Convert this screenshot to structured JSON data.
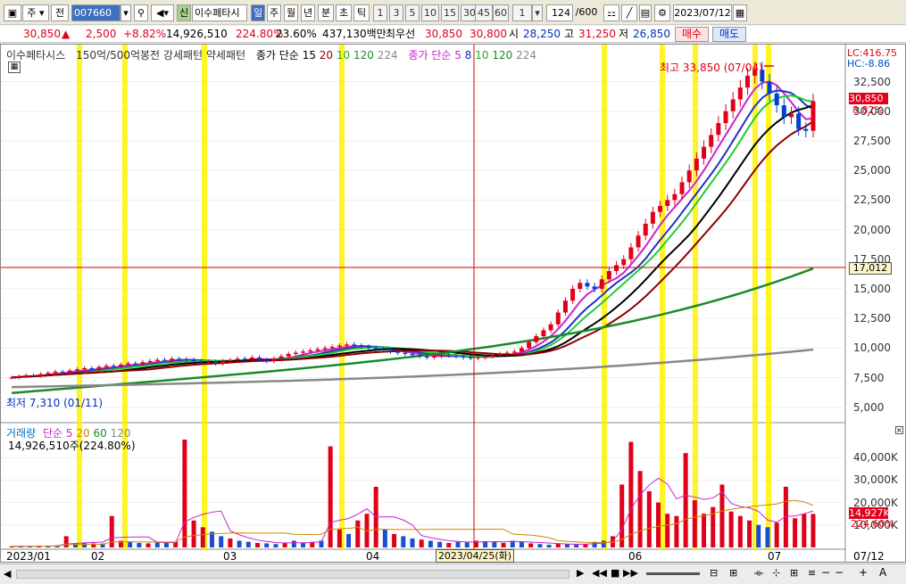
{
  "toolbar": {
    "market": "주",
    "market_type": "전",
    "code": "007660",
    "new_badge": "신",
    "stock_name": "이수페타시",
    "periods": [
      "일",
      "주",
      "월",
      "년",
      "분",
      "초",
      "틱"
    ],
    "selected_period": "일",
    "minute_intervals": [
      "1",
      "3",
      "5",
      "10",
      "15",
      "30",
      "45",
      "60"
    ],
    "interval_value": "1",
    "count": "124",
    "count_total": "/600",
    "date": "2023/07/12"
  },
  "info": {
    "price": "30,850",
    "change_arrow": "▲",
    "change": "2,500",
    "change_pct": "+8.82%",
    "volume": "14,926,510",
    "volume_ratio": "224.80%",
    "turnover": "23.60%",
    "amount": "437,130백만",
    "best_label": "최우선",
    "best_ask": "30,850",
    "best_bid": "30,800",
    "open_label": "시",
    "open": "28,250",
    "high_label": "고",
    "high": "31,250",
    "low_label": "저",
    "low": "26,850",
    "buy_button": "매수",
    "sell_button": "매도"
  },
  "chart": {
    "legend_name": "이수페타시스",
    "legend_patterns": "150억/500억봉전 강세패턴  약세패턴",
    "legend_ma_close_label": "종가 단순",
    "legend_ma_close": [
      "15",
      "20",
      "10",
      "120",
      "224"
    ],
    "legend_ma2_label": "종가 단순",
    "legend_ma2": [
      "5",
      "8",
      "10",
      "120",
      "224"
    ],
    "lc": "LC:416.75",
    "hc": "HC:-8.86",
    "high_annotation": "최고 33,850 (07/04)",
    "low_annotation": "최저 7,310 (01/11)",
    "current_price_tag": "30,850",
    "current_pct_tag": "8.82%",
    "crosshair_price": "17,012",
    "crosshair_date": "2023/04/25(화)",
    "y_ticks": [
      "32,500",
      "30,000",
      "27,500",
      "25,000",
      "22,500",
      "20,000",
      "17,500",
      "15,000",
      "12,500",
      "10,000",
      "7,500",
      "5,000"
    ],
    "x_ticks": [
      "2023/01",
      "02",
      "03",
      "04",
      "06",
      "07"
    ],
    "x_end": "07/12",
    "volume_legend_name": "거래량",
    "volume_legend_ma_label": "단순",
    "volume_legend_ma": [
      "5",
      "20",
      "60",
      "120"
    ],
    "volume_current": "14,926,510주(224.80%)",
    "vol_y_ticks": [
      "40,000K",
      "30,000K",
      "20,000K",
      "10,000K"
    ],
    "vol_current_tag": "14,927K",
    "vol_pct_tag": "224.60%"
  },
  "chart_data": {
    "type": "candlestick",
    "close_series": [
      7500,
      7600,
      7700,
      7650,
      7800,
      7900,
      8000,
      7950,
      8100,
      8200,
      8300,
      8200,
      8400,
      8500,
      8450,
      8600,
      8700,
      8650,
      8800,
      8900,
      9000,
      8950,
      9100,
      9050,
      9000,
      8900,
      8800,
      8850,
      8700,
      8900,
      9000,
      9100,
      9050,
      9200,
      9000,
      8900,
      9100,
      9300,
      9500,
      9600,
      9700,
      9800,
      9900,
      10000,
      10100,
      10200,
      10300,
      10200,
      10100,
      10000,
      9900,
      9800,
      9700,
      9600,
      9500,
      9400,
      9300,
      9200,
      9300,
      9400,
      9350,
      9300,
      9200,
      9150,
      9200,
      9300,
      9400,
      9500,
      9600,
      9700,
      10000,
      10500,
      11000,
      11500,
      12000,
      13000,
      14000,
      15000,
      15500,
      15200,
      15000,
      15800,
      16500,
      17000,
      17500,
      18500,
      19500,
      20500,
      21500,
      22000,
      22500,
      23000,
      24000,
      25000,
      26000,
      27000,
      28000,
      29000,
      30000,
      31000,
      32000,
      33000,
      33500,
      32500,
      31500,
      30500,
      29500,
      29800,
      28500,
      28350,
      30850
    ],
    "volume_k": [
      500,
      600,
      400,
      700,
      800,
      900,
      5000,
      1500,
      2000,
      1800,
      1700,
      14000,
      3000,
      2500,
      2000,
      1800,
      2200,
      2100,
      2500,
      48000,
      12000,
      9000,
      7000,
      5000,
      4000,
      3000,
      2500,
      2000,
      1800,
      1500,
      2200,
      3000,
      2000,
      2500,
      3000,
      45000,
      8000,
      6000,
      12000,
      15000,
      27000,
      8000,
      6000,
      5000,
      4000,
      3500,
      3000,
      2500,
      2000,
      2500,
      2200,
      3000,
      2800,
      2500,
      2000,
      3000,
      2500,
      1800,
      1500,
      1200,
      1800,
      1500,
      1300,
      1400,
      2500,
      3000,
      5000,
      28000,
      47000,
      34000,
      25000,
      20000,
      15000,
      14000,
      42000,
      21000,
      15000,
      18000,
      28000,
      16000,
      14000,
      12000,
      10000,
      9000,
      11000,
      27000,
      13000,
      15000,
      14927
    ]
  }
}
